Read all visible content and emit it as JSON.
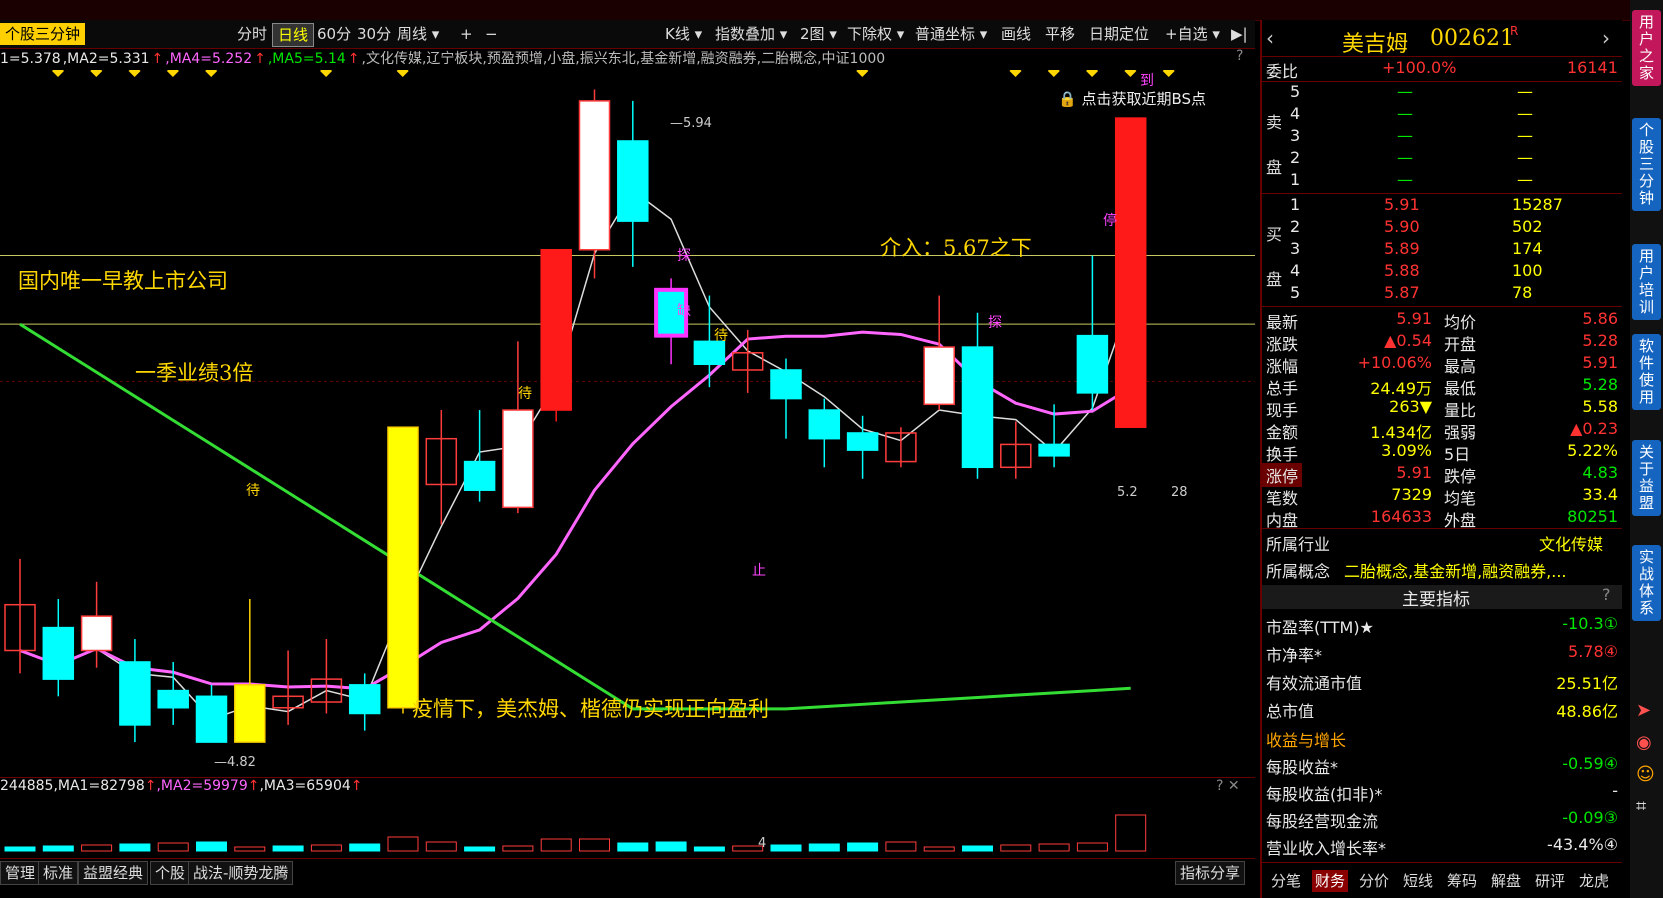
{
  "toolbar": {
    "title": "个股三分钟",
    "periods": [
      "分时",
      "日线",
      "60分",
      "30分",
      "周线"
    ],
    "active_period": "日线",
    "zoom_in": "+",
    "zoom_out": "−",
    "tools": [
      "K线",
      "指数叠加",
      "2图",
      "下除权",
      "普通坐标",
      "画线",
      "平移",
      "日期定位",
      "+自选"
    ]
  },
  "ma_line": {
    "ma1": "1=5.378",
    "ma2": ",MA2=5.331",
    "ma4": ",MA4=5.252",
    "ma5": ",MA5=5.14",
    "concepts": ",文化传媒,辽宁板块,预盈预增,小盘,振兴东北,基金新增,融资融券,二胎概念,中证1000",
    "help": "?"
  },
  "chart_notes": {
    "lock_text": "点击获取近期BS点",
    "note1": "国内唯一早教上市公司",
    "note2": "一季业绩3倍",
    "note3": "介入：5.67之下",
    "note4": "疫情下，美杰姆、楷德仍实现正向盈利",
    "high_label": "5.94",
    "low_label": "4.82",
    "right_label_a": "5.2",
    "right_label_b": "28",
    "marks": [
      "探",
      "缺",
      "待",
      "待",
      "待",
      "探",
      "止",
      "停",
      "到"
    ]
  },
  "chart_data": {
    "type": "candlestick",
    "candles": [
      {
        "o": 5.06,
        "c": 4.98,
        "h": 5.14,
        "l": 4.94,
        "color": "red-hollow"
      },
      {
        "o": 5.02,
        "c": 4.93,
        "h": 5.07,
        "l": 4.9,
        "color": "cyan"
      },
      {
        "o": 4.98,
        "c": 5.04,
        "h": 5.1,
        "l": 4.95,
        "color": "white"
      },
      {
        "o": 4.96,
        "c": 4.85,
        "h": 5.0,
        "l": 4.82,
        "color": "cyan"
      },
      {
        "o": 4.88,
        "c": 4.91,
        "h": 4.96,
        "l": 4.85,
        "color": "cyan"
      },
      {
        "o": 4.9,
        "c": 4.82,
        "h": 4.92,
        "l": 4.82,
        "color": "cyan"
      },
      {
        "o": 4.82,
        "c": 4.92,
        "h": 5.07,
        "l": 4.82,
        "color": "yellow"
      },
      {
        "o": 4.9,
        "c": 4.88,
        "h": 4.98,
        "l": 4.85,
        "color": "red-hollow"
      },
      {
        "o": 4.89,
        "c": 4.93,
        "h": 5.0,
        "l": 4.87,
        "color": "red-hollow"
      },
      {
        "o": 4.92,
        "c": 4.87,
        "h": 4.94,
        "l": 4.84,
        "color": "cyan"
      },
      {
        "o": 4.88,
        "c": 5.37,
        "h": 5.37,
        "l": 4.87,
        "color": "yellow"
      },
      {
        "o": 5.27,
        "c": 5.35,
        "h": 5.4,
        "l": 5.2,
        "color": "red-hollow"
      },
      {
        "o": 5.31,
        "c": 5.26,
        "h": 5.4,
        "l": 5.24,
        "color": "cyan"
      },
      {
        "o": 5.23,
        "c": 5.4,
        "h": 5.52,
        "l": 5.22,
        "color": "white"
      },
      {
        "o": 5.4,
        "c": 5.68,
        "h": 5.68,
        "l": 5.38,
        "color": "red"
      },
      {
        "o": 5.68,
        "c": 5.94,
        "h": 5.96,
        "l": 5.63,
        "color": "white"
      },
      {
        "o": 5.87,
        "c": 5.73,
        "h": 5.94,
        "l": 5.65,
        "color": "cyan"
      },
      {
        "o": 5.61,
        "c": 5.53,
        "h": 5.63,
        "l": 5.48,
        "color": "magenta"
      },
      {
        "o": 5.52,
        "c": 5.48,
        "h": 5.6,
        "l": 5.44,
        "color": "cyan"
      },
      {
        "o": 5.47,
        "c": 5.5,
        "h": 5.54,
        "l": 5.43,
        "color": "red-hollow"
      },
      {
        "o": 5.47,
        "c": 5.42,
        "h": 5.49,
        "l": 5.35,
        "color": "cyan"
      },
      {
        "o": 5.4,
        "c": 5.35,
        "h": 5.42,
        "l": 5.3,
        "color": "cyan"
      },
      {
        "o": 5.36,
        "c": 5.33,
        "h": 5.39,
        "l": 5.28,
        "color": "cyan"
      },
      {
        "o": 5.31,
        "c": 5.36,
        "h": 5.37,
        "l": 5.3,
        "color": "red-hollow"
      },
      {
        "o": 5.41,
        "c": 5.51,
        "h": 5.6,
        "l": 5.4,
        "color": "white"
      },
      {
        "o": 5.51,
        "c": 5.3,
        "h": 5.57,
        "l": 5.28,
        "color": "cyan"
      },
      {
        "o": 5.3,
        "c": 5.34,
        "h": 5.38,
        "l": 5.28,
        "color": "red-hollow"
      },
      {
        "o": 5.32,
        "c": 5.34,
        "h": 5.41,
        "l": 5.3,
        "color": "cyan"
      },
      {
        "o": 5.43,
        "c": 5.53,
        "h": 5.67,
        "l": 5.4,
        "color": "cyan"
      },
      {
        "o": 5.37,
        "c": 5.91,
        "h": 5.91,
        "l": 5.37,
        "color": "red"
      }
    ],
    "ref_lines": [
      5.67,
      5.55
    ],
    "ylim": [
      4.78,
      5.98
    ]
  },
  "volume": {
    "vol": "244885",
    "ma1": ",MA1=82798",
    "ma2": ",MA2=59979",
    "ma3": ",MA3=65904",
    "marker": "4"
  },
  "bottom_tabs": [
    "管理",
    "标准",
    "益盟经典",
    "个股",
    "战法-顺势龙腾"
  ],
  "share_btn": "指标分享",
  "quote": {
    "name": "美吉姆",
    "code": "002621",
    "suffix": "R",
    "weibi_label": "委比",
    "weibi_pct": "+100.0%",
    "weibi_val": "16141",
    "sell_label": "卖盘",
    "buy_label": "买盘",
    "sell": [
      {
        "lvl": "5",
        "p": "—",
        "v": "—"
      },
      {
        "lvl": "4",
        "p": "—",
        "v": "—"
      },
      {
        "lvl": "3",
        "p": "—",
        "v": "—"
      },
      {
        "lvl": "2",
        "p": "—",
        "v": "—"
      },
      {
        "lvl": "1",
        "p": "—",
        "v": "—"
      }
    ],
    "buy": [
      {
        "lvl": "1",
        "p": "5.91",
        "v": "15287"
      },
      {
        "lvl": "2",
        "p": "5.90",
        "v": "502"
      },
      {
        "lvl": "3",
        "p": "5.89",
        "v": "174"
      },
      {
        "lvl": "4",
        "p": "5.88",
        "v": "100"
      },
      {
        "lvl": "5",
        "p": "5.87",
        "v": "78"
      }
    ],
    "stats": [
      {
        "l": "最新",
        "v": "5.91",
        "l2": "均价",
        "v2": "5.86"
      },
      {
        "l": "涨跌",
        "v": "▲0.54",
        "l2": "开盘",
        "v2": "5.28"
      },
      {
        "l": "涨幅",
        "v": "+10.06%",
        "l2": "最高",
        "v2": "5.91"
      },
      {
        "l": "总手",
        "v": "24.49万",
        "l2": "最低",
        "v2": "5.28"
      },
      {
        "l": "现手",
        "v": "263▼",
        "l2": "量比",
        "v2": "5.58"
      },
      {
        "l": "金额",
        "v": "1.434亿",
        "l2": "强弱",
        "v2": "▲0.23"
      },
      {
        "l": "换手",
        "v": "3.09%",
        "l2": "5日",
        "v2": "5.22%"
      },
      {
        "l": "涨停",
        "v": "5.91",
        "l2": "跌停",
        "v2": "4.83"
      },
      {
        "l": "笔数",
        "v": "7329",
        "l2": "均笔",
        "v2": "33.4"
      },
      {
        "l": "内盘",
        "v": "164633",
        "l2": "外盘",
        "v2": "80251"
      }
    ],
    "industry_label": "所属行业",
    "industry": "文化传媒",
    "concept_label": "所属概念",
    "concept": "二胎概念,基金新增,融资融券,...",
    "main_header": "主要指标",
    "metrics": [
      {
        "l": "市盈率(TTM)★",
        "v": "-10.3①"
      },
      {
        "l": "市净率*",
        "v": "5.78④"
      },
      {
        "l": "有效流通市值",
        "v": "25.51亿"
      },
      {
        "l": "总市值",
        "v": "48.86亿"
      }
    ],
    "growth_header": "收益与增长",
    "growth": [
      {
        "l": "每股收益*",
        "v": "-0.59④"
      },
      {
        "l": "每股收益(扣非)*",
        "v": "-"
      },
      {
        "l": "每股经营现金流",
        "v": "-0.09③"
      },
      {
        "l": "营业收入增长率*",
        "v": "-43.4%④"
      }
    ],
    "tabs": [
      "分笔",
      "财务",
      "分价",
      "短线",
      "筹码",
      "解盘",
      "研评",
      "龙虎"
    ],
    "active_tab": "财务"
  },
  "sidebar": [
    "用户之家",
    "个股三分钟",
    "用户培训",
    "软件使用",
    "关于益盟",
    "实战体系"
  ]
}
